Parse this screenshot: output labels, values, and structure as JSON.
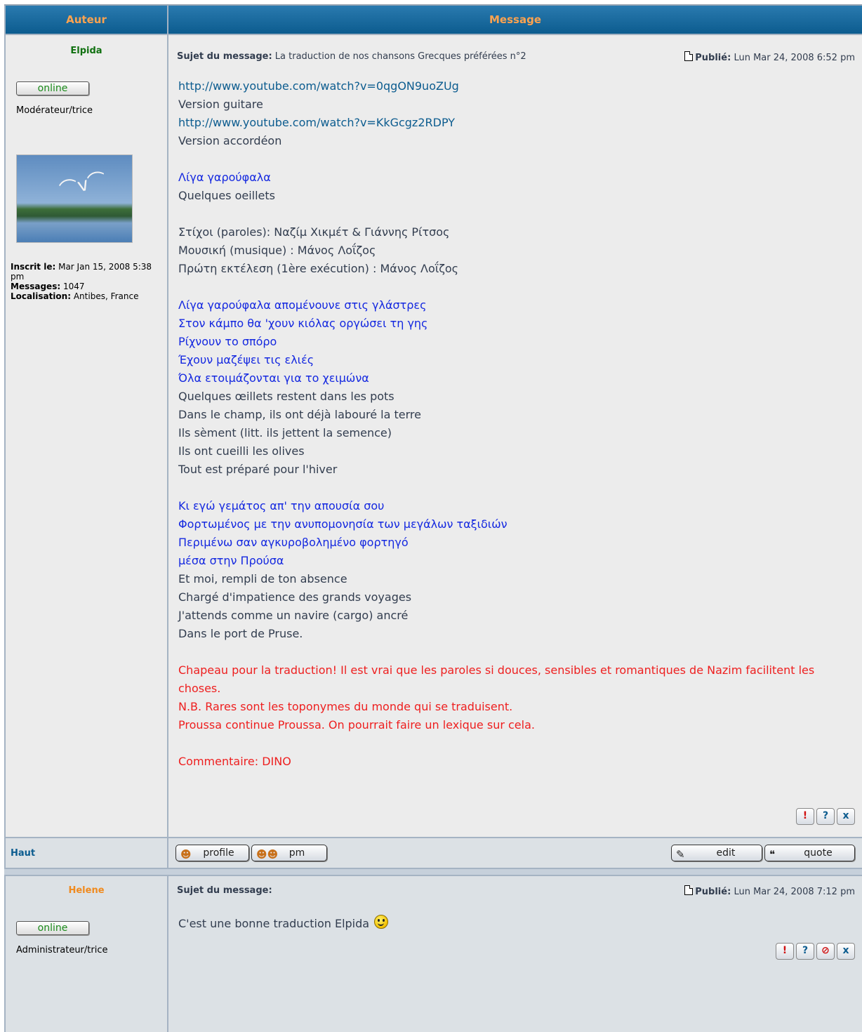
{
  "header": {
    "author_col": "Auteur",
    "message_col": "Message"
  },
  "post1": {
    "author": "Elpida",
    "online_label": "online",
    "rank": "Modérateur/trice",
    "avatar_icon": "seagull-avatar-image",
    "joined_label": "Inscrit le:",
    "joined_value": "Mar Jan 15, 2008 5:38 pm",
    "messages_label": "Messages:",
    "messages_value": "1047",
    "location_label": "Localisation:",
    "location_value": "Antibes, France",
    "subject_label": "Sujet du message:",
    "subject_value": "La traduction de nos chansons Grecques préférées n°2",
    "posted_label": "Publié:",
    "posted_value": "Lun Mar 24, 2008 6:52 pm",
    "lines": [
      "http://www.youtube.com/watch?v=0qgON9uoZUg",
      "Version guitare",
      "http://www.youtube.com/watch?v=KkGcgz2RDPY",
      "Version accordéon",
      "Λίγα γαρούφαλα",
      "Quelques oeillets",
      "Στίχοι (paroles): Ναζίμ Χικμέτ & Γιάννης Ρίτσος",
      "Μουσική (musique) : Μάνος Λοΐζος",
      "Πρώτη εκτέλεση (1ère exécution) : Μάνος Λοΐζος",
      "Λίγα γαρούφαλα απομένουνε στις γλάστρες",
      "Στον κάμπο θα 'χουν κιόλας οργώσει τη γης",
      "Ρίχνουν το σπόρο",
      "Έχουν μαζέψει τις ελιές",
      "Όλα ετοιμάζονται για το χειμώνα",
      "Quelques œillets restent dans les pots",
      "Dans le champ, ils ont déjà labouré la terre",
      "Ils sèment (litt. ils jettent la semence)",
      "Ils ont cueilli les olives",
      "Tout est préparé pour l'hiver",
      "Κι εγώ γεμάτος απ' την απουσία σου",
      "Φορτωμένος με την ανυπομονησία των μεγάλων ταξιδιών",
      "Περιμένω σαν αγκυροβολημένο φορτηγό",
      "μέσα στην Προύσα",
      "Et moi, rempli de ton absence",
      "Chargé d'impatience des grands voyages",
      "J'attends comme un navire (cargo) ancré",
      "Dans le port de Pruse.",
      "Chapeau pour la traduction! Il est vrai que les paroles si douces, sensibles et romantiques de Nazim facilitent les",
      "choses.",
      "N.B. Rares sont les toponymes du monde qui se traduisent.",
      "Proussa continue Proussa. On pourrait faire un lexique sur cela.",
      "Commentaire: DINO"
    ],
    "report_label": "!",
    "info_label": "?",
    "delete_label": "x"
  },
  "footer": {
    "top_link": "Haut",
    "profile_label": "profile",
    "pm_label": "pm",
    "edit_label": "edit",
    "quote_label": "quote"
  },
  "post2": {
    "author": "Helene",
    "online_label": "online",
    "rank": "Administrateur/trice",
    "subject_label": "Sujet du message:",
    "posted_label": "Publié:",
    "posted_value": "Lun Mar 24, 2008 7:12 pm",
    "text": "C'est une bonne traduction Elpida",
    "report_label": "!",
    "info_label": "?",
    "ban_label": "⃠",
    "delete_label": "x"
  },
  "colors": {
    "header_bg": "#0c5c8f",
    "header_text": "#ffa34f",
    "link": "#0c5c8f",
    "greek_text": "#1428e0",
    "comment_text": "#ee1f1f",
    "moderator_name": "#107010",
    "admin_name": "#f08a1e"
  }
}
